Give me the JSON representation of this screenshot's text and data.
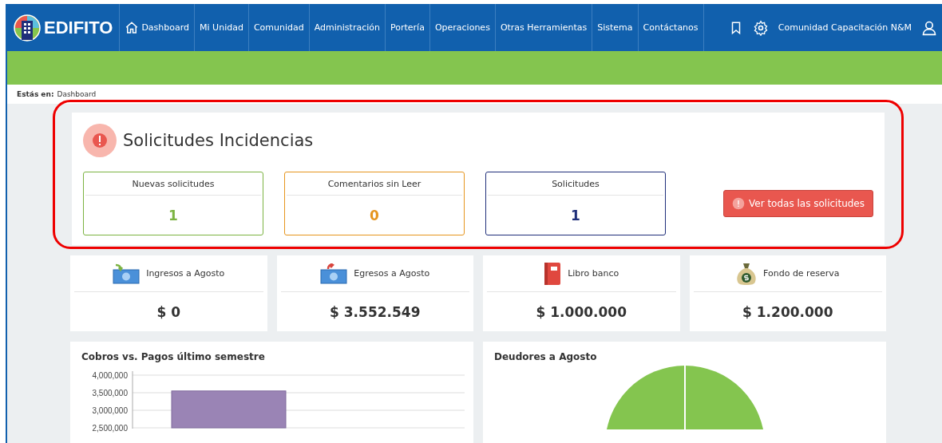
{
  "brand": {
    "name": "EDIFITO"
  },
  "nav": [
    {
      "label": "Dashboard",
      "kind": "home"
    },
    {
      "label": "Mi Unidad",
      "kind": "plain"
    },
    {
      "label": "Comunidad",
      "kind": "plain"
    },
    {
      "label": "Administración",
      "kind": "plain"
    },
    {
      "label": "Portería",
      "kind": "plain"
    },
    {
      "label": "Operaciones",
      "kind": "plain"
    },
    {
      "label": "Otras Herramientas",
      "kind": "plain"
    },
    {
      "label": "Sistema",
      "kind": "plain"
    },
    {
      "label": "Contáctanos",
      "kind": "plain"
    }
  ],
  "user": {
    "name": "Comunidad Capacitación N&M"
  },
  "breadcrumb": {
    "label": "Estás en:",
    "page": "Dashboard"
  },
  "incidents": {
    "title": "Solicitudes Incidencias",
    "highlighted": true,
    "counters": [
      {
        "label": "Nuevas solicitudes",
        "value": "1",
        "color": "#7cb342"
      },
      {
        "label": "Comentarios sin Leer",
        "value": "0",
        "color": "#e6951e"
      },
      {
        "label": "Solicitudes",
        "value": "1",
        "color": "#1f2f7a"
      }
    ],
    "button": "Ver todas las solicitudes"
  },
  "stats": [
    {
      "label": "Ingresos a Agosto",
      "value": "$ 0",
      "kind": "income"
    },
    {
      "label": "Egresos a Agosto",
      "value": "$ 3.552.549",
      "kind": "expense"
    },
    {
      "label": "Libro banco",
      "value": "$ 1.000.000",
      "kind": "book"
    },
    {
      "label": "Fondo de reserva",
      "value": "$ 1.200.000",
      "kind": "moneybag"
    }
  ],
  "charts": [
    {
      "title": "Cobros vs. Pagos último semestre",
      "chart_data": {
        "type": "bar",
        "values": [
          3550000
        ],
        "yticks": [
          {
            "value": 2500000,
            "label": "2,500,000"
          },
          {
            "value": 3000000,
            "label": "3,000,000"
          },
          {
            "value": 3500000,
            "label": "3,500,000"
          },
          {
            "value": 4000000,
            "label": "4,000,000"
          }
        ],
        "ylim": [
          2500000,
          4000000
        ]
      }
    },
    {
      "title": "Deudores a Agosto",
      "kind": "pie"
    }
  ]
}
